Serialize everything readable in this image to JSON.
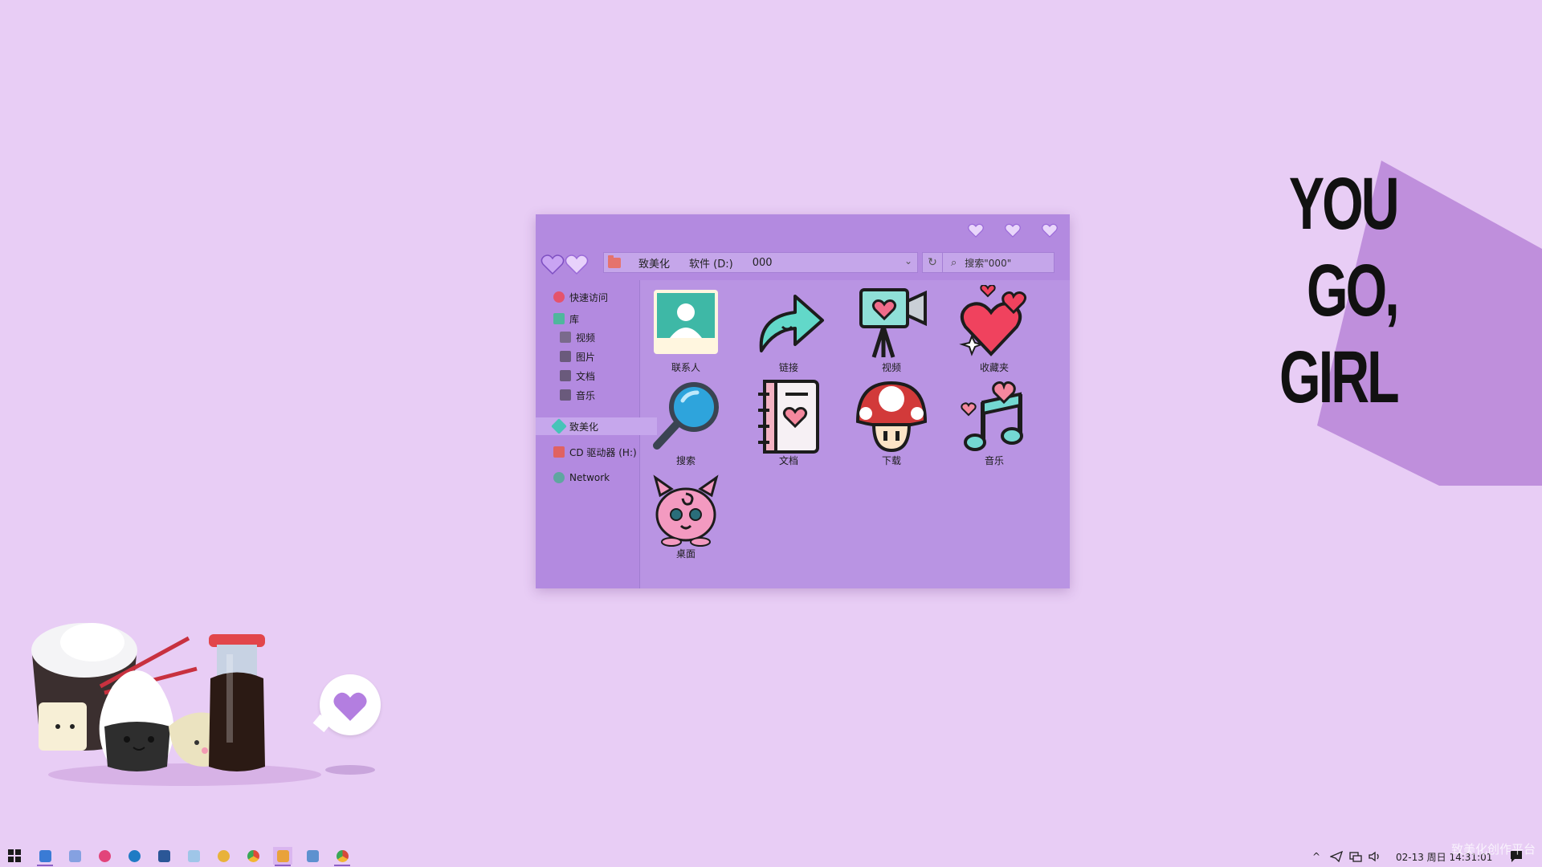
{
  "colors": {
    "desktop_bg": "#e8cdf5",
    "window_bg": "#b994e3",
    "accent": "#9a6ad8",
    "poster_shadow": "#bf8fdc",
    "text": "#1b1b1b"
  },
  "poster": {
    "lines": [
      "YOU",
      "GO,",
      "GIRL"
    ]
  },
  "window": {
    "title_buttons": [
      "minimize-heart-icon",
      "maximize-heart-icon",
      "close-heart-icon"
    ],
    "nav_buttons": [
      "back-heart-icon",
      "forward-heart-icon"
    ],
    "address": {
      "crumbs": [
        "致美化",
        "软件 (D:)",
        "000"
      ],
      "dropdown_icon": "⌄",
      "refresh_icon": "↻"
    },
    "search": {
      "icon": "⌕",
      "placeholder": "搜索\"000\""
    },
    "sidebar": [
      {
        "label": "快速访问",
        "icon": "heart-star-icon",
        "color": "#e5536c",
        "selected": false
      },
      {
        "label": "库",
        "icon": "library-icon",
        "color": "#4fb79d",
        "selected": false
      },
      {
        "label": "视频",
        "icon": "video-icon",
        "color": "#7a6a8c",
        "selected": false
      },
      {
        "label": "图片",
        "icon": "camera-icon",
        "color": "#6a5a7c",
        "selected": false
      },
      {
        "label": "文档",
        "icon": "document-icon",
        "color": "#6a5a7c",
        "selected": false
      },
      {
        "label": "音乐",
        "icon": "music-icon",
        "color": "#6a5a7c",
        "selected": false
      },
      {
        "label": "致美化",
        "icon": "gem-icon",
        "color": "#47c4b8",
        "selected": true
      },
      {
        "label": "CD 驱动器 (H:)",
        "icon": "cd-drive-icon",
        "color": "#e06262",
        "selected": false
      },
      {
        "label": "Network",
        "icon": "globe-icon",
        "color": "#5fa6a0",
        "selected": false
      }
    ],
    "files": [
      {
        "label": "联系人",
        "icon": "contact-icon"
      },
      {
        "label": "链接",
        "icon": "link-arrow-icon"
      },
      {
        "label": "视频",
        "icon": "video-camera-icon"
      },
      {
        "label": "收藏夹",
        "icon": "favorites-heart-icon"
      },
      {
        "label": "搜索",
        "icon": "magnifier-icon"
      },
      {
        "label": "文档",
        "icon": "notebook-icon"
      },
      {
        "label": "下载",
        "icon": "mushroom-icon"
      },
      {
        "label": "音乐",
        "icon": "music-note-icon"
      },
      {
        "label": "桌面",
        "icon": "jigglypuff-icon"
      }
    ]
  },
  "taskbar": {
    "apps": [
      {
        "name": "start-icon",
        "color": "#1a1a1a"
      },
      {
        "name": "widgets-icon",
        "color": "#3a7bd5"
      },
      {
        "name": "window-app-icon",
        "color": "#5b8fd8"
      },
      {
        "name": "xiu-app-icon",
        "color": "#e2447a"
      },
      {
        "name": "edge-icon",
        "color": "#1f7bc4"
      },
      {
        "name": "word-icon",
        "color": "#2b5797"
      },
      {
        "name": "photoshop-icon",
        "color": "#9fc6e8"
      },
      {
        "name": "fruit-app-icon",
        "color": "#e8b23a"
      },
      {
        "name": "chrome-icon",
        "color": "#e04a3a"
      },
      {
        "name": "file-explorer-icon",
        "color": "#e9a23b"
      },
      {
        "name": "notepad-icon",
        "color": "#3a82c6"
      },
      {
        "name": "chrome-alt-icon",
        "color": "#d64a3a"
      }
    ],
    "tray": {
      "chevron": "^",
      "datetime": "02-13 周日 14:31:01"
    }
  },
  "watermark": "致美化创作平台"
}
